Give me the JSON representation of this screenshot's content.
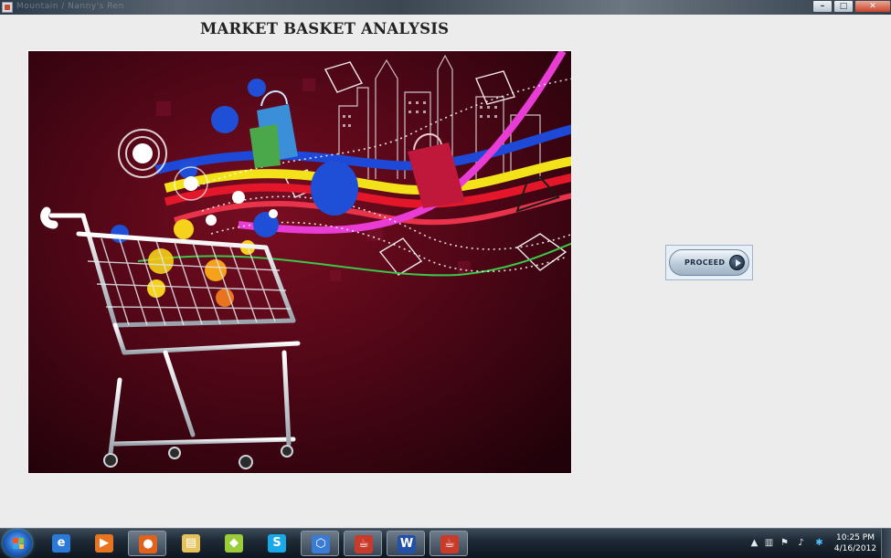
{
  "window": {
    "title": "Mountain / Nanny's Ren",
    "buttons": {
      "minimize": "–",
      "maximize": "□",
      "close": "✕"
    }
  },
  "main": {
    "title": "MARKET BASKET ANALYSIS",
    "image_description_icon": "shopping-cart-illustration",
    "proceed_label": "PROCEED"
  },
  "taskbar": {
    "items": [
      {
        "name": "internet-explorer",
        "glyph": "e",
        "color": "#2a7ad8"
      },
      {
        "name": "media-player",
        "glyph": "▶",
        "color": "#e8741f"
      },
      {
        "name": "firefox",
        "glyph": "●",
        "color": "#e0621c"
      },
      {
        "name": "file-explorer",
        "glyph": "▤",
        "color": "#e6c35a"
      },
      {
        "name": "sticky-app",
        "glyph": "◆",
        "color": "#9ccc3a"
      },
      {
        "name": "skype",
        "glyph": "S",
        "color": "#19a8e8"
      },
      {
        "name": "virtualbox",
        "glyph": "⬡",
        "color": "#3a7bd5"
      },
      {
        "name": "java-app-1",
        "glyph": "☕",
        "color": "#c83a2a"
      },
      {
        "name": "word",
        "glyph": "W",
        "color": "#2451a8"
      },
      {
        "name": "java-app-2",
        "glyph": "☕",
        "color": "#c83a2a"
      }
    ],
    "clock": {
      "time": "10:25 PM",
      "date": "4/16/2012"
    }
  }
}
